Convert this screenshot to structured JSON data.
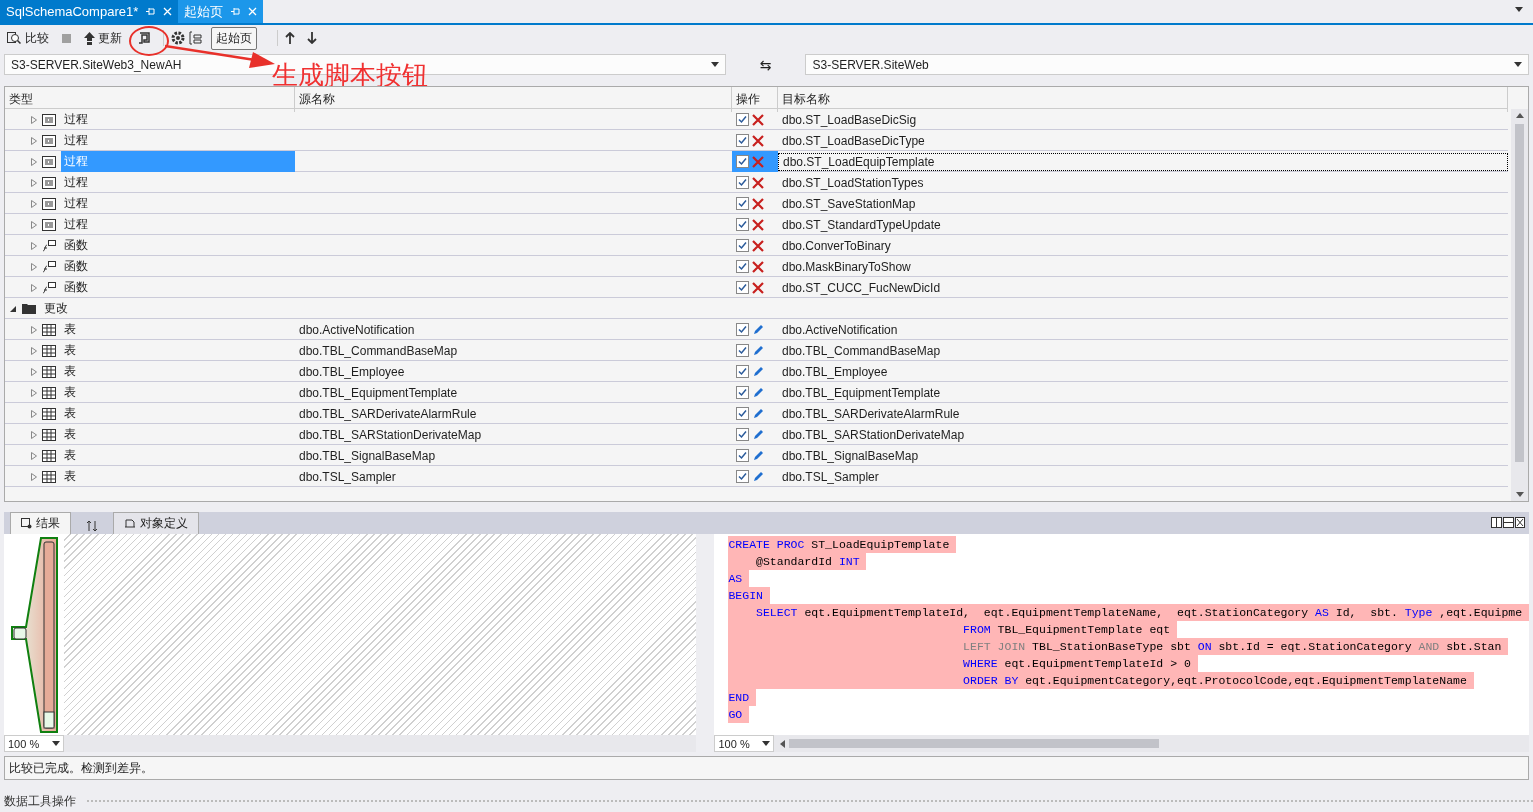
{
  "doc_tabs": [
    {
      "label": "SqlSchemaCompare1*",
      "selected": true
    },
    {
      "label": "起始页",
      "selected": false
    }
  ],
  "toolbar": {
    "compare_label": "比较",
    "update_label": "更新",
    "tooltip": "起始页"
  },
  "annotation": {
    "text": "生成脚本按钮"
  },
  "source_db": "S3-SERVER.SiteWeb3_NewAH",
  "swap_icon": "⇆",
  "target_db": "S3-SERVER.SiteWeb",
  "grid": {
    "columns": [
      "类型",
      "源名称",
      "操作",
      "目标名称"
    ],
    "groups": [
      {
        "children": [
          {
            "kind": "procedure",
            "type": "过程",
            "checked": true,
            "target": "dbo.ST_LoadBaseDicSig",
            "selected": false
          },
          {
            "kind": "procedure",
            "type": "过程",
            "checked": true,
            "target": "dbo.ST_LoadBaseDicType",
            "selected": false
          },
          {
            "kind": "procedure",
            "type": "过程",
            "checked": true,
            "target": "dbo.ST_LoadEquipTemplate",
            "selected": true
          },
          {
            "kind": "procedure",
            "type": "过程",
            "checked": true,
            "target": "dbo.ST_LoadStationTypes",
            "selected": false
          },
          {
            "kind": "procedure",
            "type": "过程",
            "checked": true,
            "target": "dbo.ST_SaveStationMap",
            "selected": false
          },
          {
            "kind": "procedure",
            "type": "过程",
            "checked": true,
            "target": "dbo.ST_StandardTypeUpdate",
            "selected": false
          },
          {
            "kind": "function",
            "type": "函数",
            "checked": true,
            "target": "dbo.ConverToBinary",
            "selected": false
          },
          {
            "kind": "function",
            "type": "函数",
            "checked": true,
            "target": "dbo.MaskBinaryToShow",
            "selected": false
          },
          {
            "kind": "function",
            "type": "函数",
            "checked": true,
            "target": "dbo.ST_CUCC_FucNewDicId",
            "selected": false
          }
        ]
      },
      {
        "label": "更改",
        "expanded": true,
        "children": [
          {
            "kind": "table",
            "type": "表",
            "source": "dbo.ActiveNotification",
            "checked": true,
            "target": "dbo.ActiveNotification",
            "selected": false
          },
          {
            "kind": "table",
            "type": "表",
            "source": "dbo.TBL_CommandBaseMap",
            "checked": true,
            "target": "dbo.TBL_CommandBaseMap",
            "selected": false
          },
          {
            "kind": "table",
            "type": "表",
            "source": "dbo.TBL_Employee",
            "checked": true,
            "target": "dbo.TBL_Employee",
            "selected": false
          },
          {
            "kind": "table",
            "type": "表",
            "source": "dbo.TBL_EquipmentTemplate",
            "checked": true,
            "target": "dbo.TBL_EquipmentTemplate",
            "selected": false
          },
          {
            "kind": "table",
            "type": "表",
            "source": "dbo.TBL_SARDerivateAlarmRule",
            "checked": true,
            "target": "dbo.TBL_SARDerivateAlarmRule",
            "selected": false
          },
          {
            "kind": "table",
            "type": "表",
            "source": "dbo.TBL_SARStationDerivateMap",
            "checked": true,
            "target": "dbo.TBL_SARStationDerivateMap",
            "selected": false
          },
          {
            "kind": "table",
            "type": "表",
            "source": "dbo.TBL_SignalBaseMap",
            "checked": true,
            "target": "dbo.TBL_SignalBaseMap",
            "selected": false
          },
          {
            "kind": "table",
            "type": "表",
            "source": "dbo.TSL_Sampler",
            "checked": true,
            "target": "dbo.TSL_Sampler",
            "selected": false
          }
        ]
      }
    ]
  },
  "bottom_tabs": [
    {
      "kind": "results",
      "label": "结果",
      "selected": true
    },
    {
      "kind": "sort",
      "selected": false
    },
    {
      "kind": "object",
      "label": "对象定义",
      "selected": false
    }
  ],
  "left_zoom": "100 %",
  "right_zoom": "100 %",
  "code_lines": [
    [
      {
        "text": "CREATE PROC",
        "kind": "kw"
      },
      {
        "text": "ST_LoadEquipTemplate",
        "kind": "plain"
      }
    ],
    [
      {
        "text": "@StandardId",
        "kind": "plain"
      },
      {
        "text": "INT",
        "kind": "kw"
      }
    ],
    [
      {
        "text": "AS",
        "kind": "kw"
      }
    ],
    [
      {
        "text": "BEGIN",
        "kind": "kw"
      }
    ],
    [
      {
        "text": "SELECT",
        "kind": "kw"
      },
      {
        "text": "eqt.EquipmentTemplateId,  eqt.EquipmentTemplateName,  eqt.StationCategory",
        "kind": "plain"
      },
      {
        "text": "AS",
        "kind": "kw"
      },
      {
        "text": "Id,  sbt.",
        "kind": "plain"
      },
      {
        "text": "Type",
        "kind": "kw"
      },
      {
        "text": ",eqt.Equipme",
        "kind": "plain"
      }
    ],
    [
      {
        "text": "FROM",
        "kind": "kw"
      },
      {
        "text": "TBL_EquipmentTemplate eqt",
        "kind": "plain"
      }
    ],
    [
      {
        "text": "LEFT JOIN",
        "kind": "gray"
      },
      {
        "text": "TBL_StationBaseType sbt",
        "kind": "plain"
      },
      {
        "text": "ON",
        "kind": "kw"
      },
      {
        "text": "sbt.Id = eqt.StationCategory",
        "kind": "plain"
      },
      {
        "text": "AND",
        "kind": "gray"
      },
      {
        "text": "sbt.Stan",
        "kind": "plain"
      }
    ],
    [
      {
        "text": "WHERE",
        "kind": "kw"
      },
      {
        "text": "eqt.EquipmentTemplateId > 0",
        "kind": "plain"
      }
    ],
    [
      {
        "text": "ORDER BY",
        "kind": "kw"
      },
      {
        "text": "eqt.EquipmentCategory,eqt.ProtocolCode,eqt.EquipmentTemplateName",
        "kind": "plain"
      }
    ],
    [
      {
        "text": "END",
        "kind": "kw"
      }
    ],
    [
      {
        "text": "GO",
        "kind": "kw"
      }
    ]
  ],
  "status": "比较已完成。检测到差异。",
  "footer": "数据工具操作"
}
